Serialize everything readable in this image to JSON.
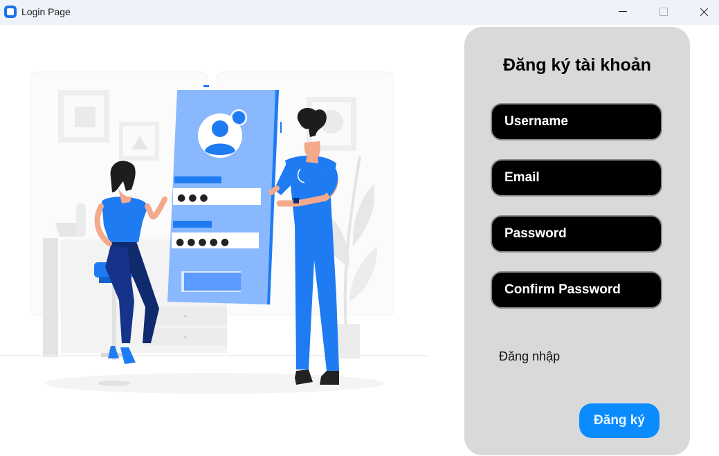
{
  "window": {
    "title": "Login Page",
    "app_icon": "app-icon",
    "controls": [
      "minimize-icon",
      "maximize-icon",
      "close-icon"
    ]
  },
  "illustration": {
    "subject": "login-illustration",
    "password_mask_1": "●●●",
    "password_mask_2": "●●●●●"
  },
  "form": {
    "title": "Đăng ký tài khoản",
    "username_placeholder": "Username",
    "email_placeholder": "Email",
    "password_placeholder": "Password",
    "confirm_password_placeholder": "Confirm Password",
    "login_link": "Đăng nhập",
    "submit_label": "Đăng ký"
  },
  "colors": {
    "titlebar": "#eef3fa",
    "panel": "#d9d9d9",
    "field_bg": "#000000",
    "accent": "#0a8cff",
    "illustration_blue": "#1f7bf2",
    "illustration_light_blue": "#8ab8ff"
  }
}
